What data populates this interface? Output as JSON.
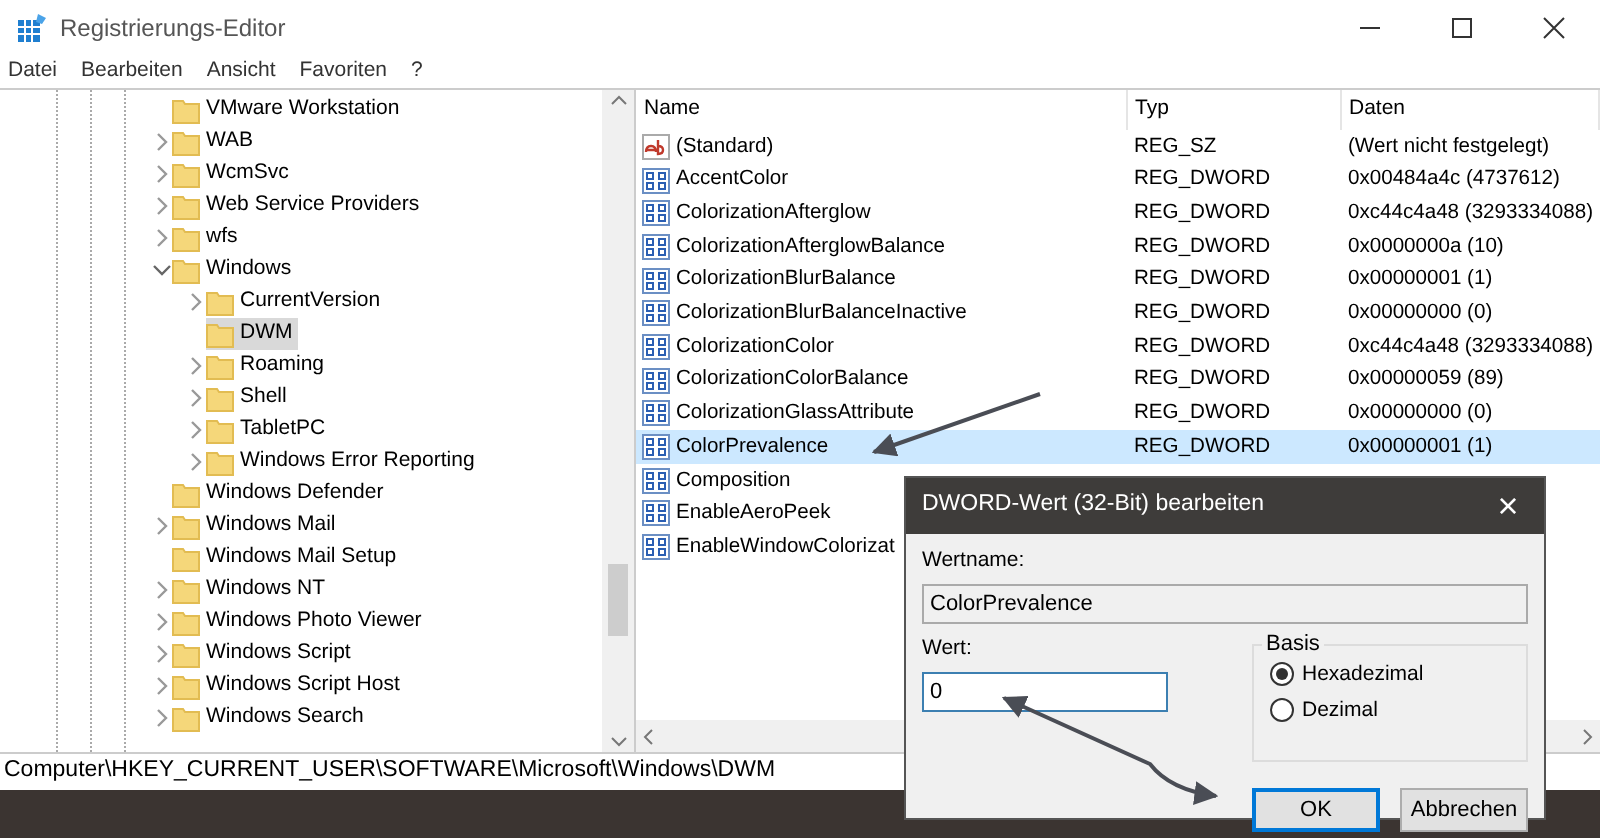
{
  "window": {
    "title": "Registrierungs-Editor"
  },
  "menu": [
    "Datei",
    "Bearbeiten",
    "Ansicht",
    "Favoriten",
    "?"
  ],
  "tree": [
    {
      "label": "VMware Workstation",
      "kind": "leaf",
      "selected": false
    },
    {
      "label": "WAB",
      "kind": "expandable",
      "expanded": false,
      "selected": false
    },
    {
      "label": "WcmSvc",
      "kind": "expandable",
      "expanded": false,
      "selected": false
    },
    {
      "label": "Web Service Providers",
      "kind": "expandable",
      "expanded": false,
      "selected": false
    },
    {
      "label": "wfs",
      "kind": "expandable",
      "expanded": false,
      "selected": false
    },
    {
      "label": "Windows",
      "kind": "expandable",
      "expanded": true,
      "selected": false,
      "children": [
        {
          "label": "CurrentVersion",
          "kind": "expandable",
          "expanded": false,
          "selected": false
        },
        {
          "label": "DWM",
          "kind": "leaf",
          "selected": true
        },
        {
          "label": "Roaming",
          "kind": "expandable",
          "expanded": false,
          "selected": false
        },
        {
          "label": "Shell",
          "kind": "expandable",
          "expanded": false,
          "selected": false
        },
        {
          "label": "TabletPC",
          "kind": "expandable",
          "expanded": false,
          "selected": false
        },
        {
          "label": "Windows Error Reporting",
          "kind": "expandable",
          "expanded": false,
          "selected": false
        }
      ]
    },
    {
      "label": "Windows Defender",
      "kind": "leaf",
      "selected": false
    },
    {
      "label": "Windows Mail",
      "kind": "expandable",
      "expanded": false,
      "selected": false
    },
    {
      "label": "Windows Mail Setup",
      "kind": "leaf",
      "selected": false
    },
    {
      "label": "Windows NT",
      "kind": "expandable",
      "expanded": false,
      "selected": false
    },
    {
      "label": "Windows Photo Viewer",
      "kind": "expandable",
      "expanded": false,
      "selected": false
    },
    {
      "label": "Windows Script",
      "kind": "expandable",
      "expanded": false,
      "selected": false
    },
    {
      "label": "Windows Script Host",
      "kind": "expandable",
      "expanded": false,
      "selected": false
    },
    {
      "label": "Windows Search",
      "kind": "expandable",
      "expanded": false,
      "selected": false
    }
  ],
  "table": {
    "columns": [
      "Name",
      "Typ",
      "Daten"
    ],
    "rows": [
      {
        "kind": "string",
        "name": "(Standard)",
        "type": "REG_SZ",
        "data": "(Wert nicht festgelegt)",
        "selected": false
      },
      {
        "kind": "dword",
        "name": "AccentColor",
        "type": "REG_DWORD",
        "data": "0x00484a4c (4737612)",
        "selected": false
      },
      {
        "kind": "dword",
        "name": "ColorizationAfterglow",
        "type": "REG_DWORD",
        "data": "0xc44c4a48 (3293334088)",
        "selected": false
      },
      {
        "kind": "dword",
        "name": "ColorizationAfterglowBalance",
        "type": "REG_DWORD",
        "data": "0x0000000a (10)",
        "selected": false
      },
      {
        "kind": "dword",
        "name": "ColorizationBlurBalance",
        "type": "REG_DWORD",
        "data": "0x00000001 (1)",
        "selected": false
      },
      {
        "kind": "dword",
        "name": "ColorizationBlurBalanceInactive",
        "type": "REG_DWORD",
        "data": "0x00000000 (0)",
        "selected": false
      },
      {
        "kind": "dword",
        "name": "ColorizationColor",
        "type": "REG_DWORD",
        "data": "0xc44c4a48 (3293334088)",
        "selected": false
      },
      {
        "kind": "dword",
        "name": "ColorizationColorBalance",
        "type": "REG_DWORD",
        "data": "0x00000059 (89)",
        "selected": false
      },
      {
        "kind": "dword",
        "name": "ColorizationGlassAttribute",
        "type": "REG_DWORD",
        "data": "0x00000000 (0)",
        "selected": false
      },
      {
        "kind": "dword",
        "name": "ColorPrevalence",
        "type": "REG_DWORD",
        "data": "0x00000001 (1)",
        "selected": true
      },
      {
        "kind": "dword",
        "name": "Composition",
        "selected": false
      },
      {
        "kind": "dword",
        "name": "EnableAeroPeek",
        "selected": false
      },
      {
        "kind": "dword",
        "name": "EnableWindowColorizat",
        "selected": false
      }
    ]
  },
  "status_bar": "Computer\\HKEY_CURRENT_USER\\SOFTWARE\\Microsoft\\Windows\\DWM",
  "dialog": {
    "title": "DWORD-Wert (32-Bit) bearbeiten",
    "close": "×",
    "name_label": "Wertname:",
    "name_value": "ColorPrevalence",
    "value_label": "Wert:",
    "value": "0",
    "base_label": "Basis",
    "bases": [
      {
        "label": "Hexadezimal",
        "selected": true
      },
      {
        "label": "Dezimal",
        "selected": false
      }
    ],
    "buttons": [
      {
        "label": "OK",
        "default": true
      },
      {
        "label": "Abbrechen",
        "default": false
      }
    ]
  }
}
